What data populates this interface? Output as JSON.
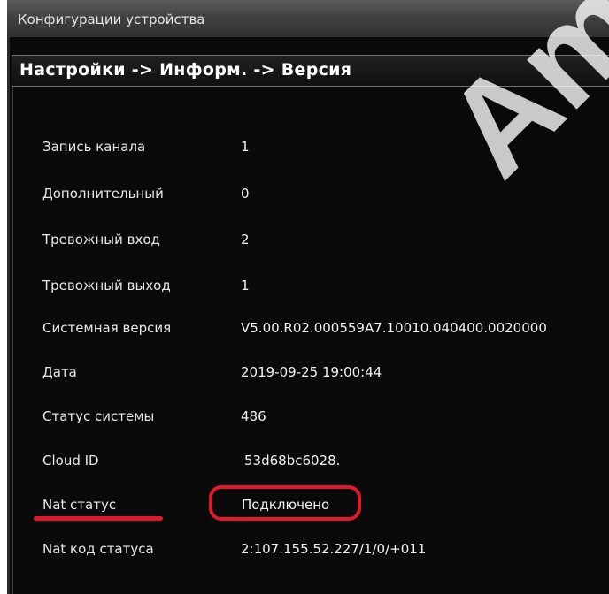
{
  "window": {
    "title": "Конфигурации устройства",
    "breadcrumb": "Настройки -> Информ. -> Версия"
  },
  "info_rows": [
    {
      "label": "Запись канала",
      "value": "1"
    },
    {
      "label": "Дополнительный",
      "value": "0"
    },
    {
      "label": "Тревожный вход",
      "value": "2"
    },
    {
      "label": "Тревожный выход",
      "value": "1"
    },
    {
      "label": "Системная версия",
      "value": "V5.00.R02.000559A7.10010.040400.0020000"
    },
    {
      "label": "Дата",
      "value": "2019-09-25 19:00:44"
    },
    {
      "label": "Статус системы",
      "value": "486"
    },
    {
      "label": "Cloud ID",
      "value": "53d68bc6028."
    },
    {
      "label": "Nat статус",
      "value": "Подключено"
    },
    {
      "label": "Nat код статуса",
      "value": "2:107.155.52.227/1/0/+011"
    }
  ],
  "overlay": {
    "watermark_text": "Ama",
    "annotation_color": "#e01a2a"
  }
}
